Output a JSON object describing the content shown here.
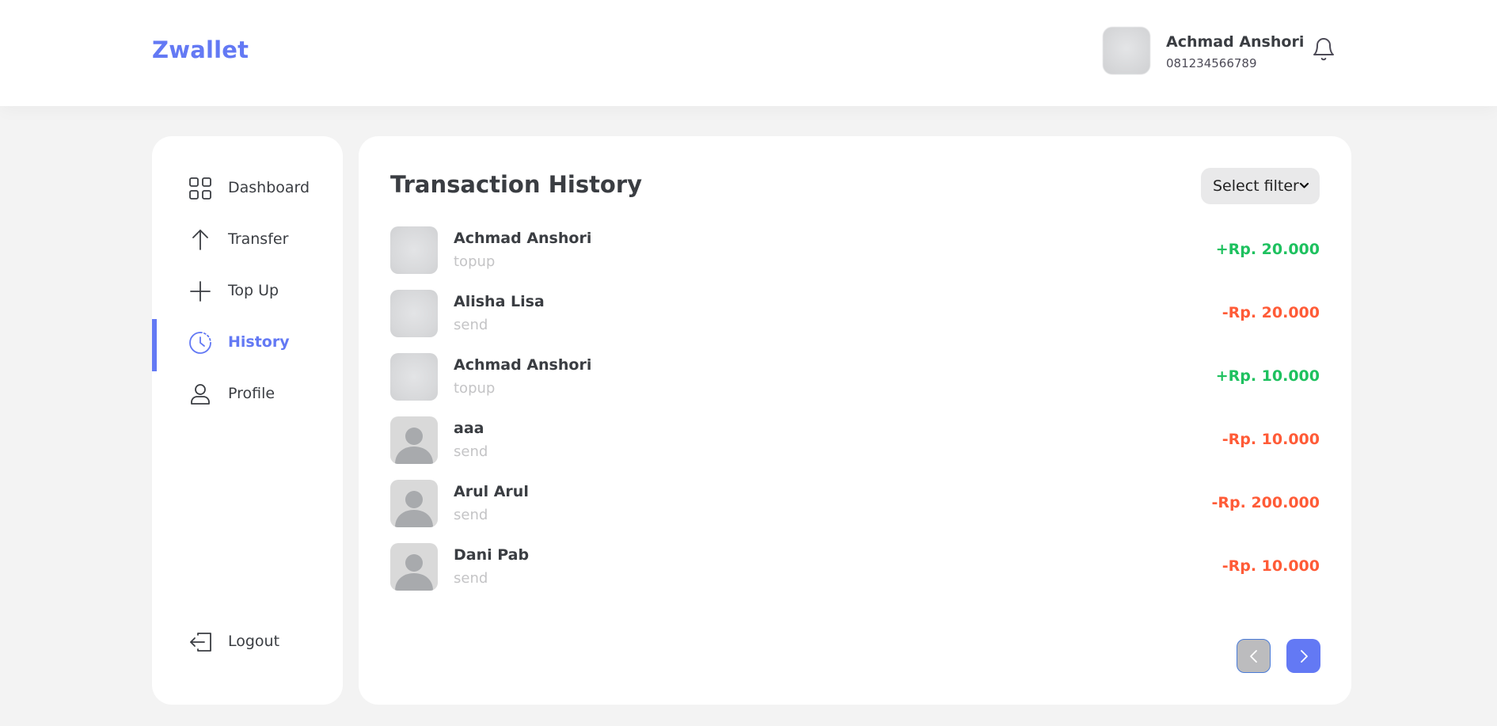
{
  "header": {
    "brand": "Zwallet",
    "user_name": "Achmad Anshori",
    "user_phone": "081234566789",
    "notification_icon": "bell-icon"
  },
  "sidebar": {
    "items": [
      {
        "label": "Dashboard",
        "icon": "grid-icon",
        "active": false
      },
      {
        "label": "Transfer",
        "icon": "arrow-up-icon",
        "active": false
      },
      {
        "label": "Top Up",
        "icon": "plus-icon",
        "active": false
      },
      {
        "label": "History",
        "icon": "clock-icon",
        "active": true
      },
      {
        "label": "Profile",
        "icon": "user-icon",
        "active": false
      }
    ],
    "logout_label": "Logout",
    "logout_icon": "logout-icon"
  },
  "main": {
    "title": "Transaction History",
    "filter_label": "Select filter",
    "transactions": [
      {
        "name": "Achmad Anshori",
        "type": "topup",
        "amount": "+Rp. 20.000",
        "direction": "in"
      },
      {
        "name": "Alisha Lisa",
        "type": "send",
        "amount": "-Rp. 20.000",
        "direction": "out"
      },
      {
        "name": "Achmad Anshori",
        "type": "topup",
        "amount": "+Rp. 10.000",
        "direction": "in"
      },
      {
        "name": "aaa",
        "type": "send",
        "amount": "-Rp. 10.000",
        "direction": "out"
      },
      {
        "name": "Arul Arul",
        "type": "send",
        "amount": "-Rp. 200.000",
        "direction": "out"
      },
      {
        "name": "Dani Pab",
        "type": "send",
        "amount": "-Rp. 10.000",
        "direction": "out"
      }
    ]
  },
  "colors": {
    "accent": "#6379f4",
    "positive": "#1ec15f",
    "negative": "#ff5b37"
  }
}
